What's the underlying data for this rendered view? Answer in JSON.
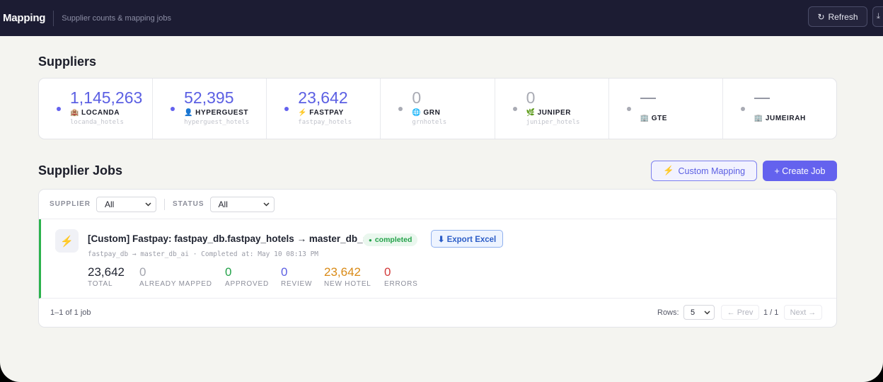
{
  "header": {
    "title": "Mapping",
    "subtitle": "Supplier counts & mapping jobs",
    "refresh_label": "Refresh",
    "refresh_icon": "↻",
    "extra_icon": "⤓"
  },
  "suppliers": {
    "heading": "Suppliers",
    "items": [
      {
        "count": "1,145,263",
        "name": "LOCANDA",
        "table": "locanda_hotels",
        "icon": "🏨",
        "dot_color": "#6462ee",
        "count_color": "#5b5fe3"
      },
      {
        "count": "52,395",
        "name": "HYPERGUEST",
        "table": "hyperguest_hotels",
        "icon": "👤",
        "dot_color": "#6462ee",
        "count_color": "#5b5fe3"
      },
      {
        "count": "23,642",
        "name": "FASTPAY",
        "table": "fastpay_hotels",
        "icon": "⚡",
        "dot_color": "#6462ee",
        "count_color": "#5b5fe3"
      },
      {
        "count": "0",
        "name": "GRN",
        "table": "grnhotels",
        "icon": "🌐",
        "dot_color": "#a9abb4",
        "count_color": "#a9abb4"
      },
      {
        "count": "0",
        "name": "JUNIPER",
        "table": "juniper_hotels",
        "icon": "🌿",
        "dot_color": "#a9abb4",
        "count_color": "#a9abb4"
      },
      {
        "count": "",
        "name": "GTE",
        "table": "",
        "icon": "🏢",
        "dot_color": "#a9abb4",
        "count_color": "#a9abb4"
      },
      {
        "count": "",
        "name": "JUMEIRAH",
        "table": "",
        "icon": "🏢",
        "dot_color": "#a9abb4",
        "count_color": "#a9abb4"
      }
    ]
  },
  "jobs": {
    "heading": "Supplier Jobs",
    "custom_mapping_label": "Custom Mapping",
    "custom_mapping_icon": "⚡",
    "create_job_label": "+ Create Job",
    "filters": {
      "supplier_label": "SUPPLIER",
      "supplier_value": "All",
      "status_label": "STATUS",
      "status_value": "All"
    },
    "items": [
      {
        "icon": "⚡",
        "title": "[Custom] Fastpay: fastpay_db.fastpay_hotels → master_db_ai",
        "status": "completed",
        "export_label": "⬇ Export Excel",
        "meta": "fastpay_db → master_db_ai · Completed at: May 10 08:13 PM",
        "stats": [
          {
            "value": "23,642",
            "label": "TOTAL",
            "color": "#1f2330"
          },
          {
            "value": "0",
            "label": "ALREADY MAPPED",
            "color": "#a3a5ae"
          },
          {
            "value": "0",
            "label": "APPROVED",
            "color": "#23a249"
          },
          {
            "value": "0",
            "label": "REVIEW",
            "color": "#5b5fe3"
          },
          {
            "value": "23,642",
            "label": "NEW HOTEL",
            "color": "#d98a16"
          },
          {
            "value": "0",
            "label": "ERRORS",
            "color": "#d23b3b"
          }
        ]
      }
    ],
    "pagination": {
      "range_text": "1–1 of 1 job",
      "rows_label": "Rows:",
      "rows_value": "5",
      "prev_label": "← Prev",
      "page_text": "1 / 1",
      "next_label": "Next →"
    }
  }
}
